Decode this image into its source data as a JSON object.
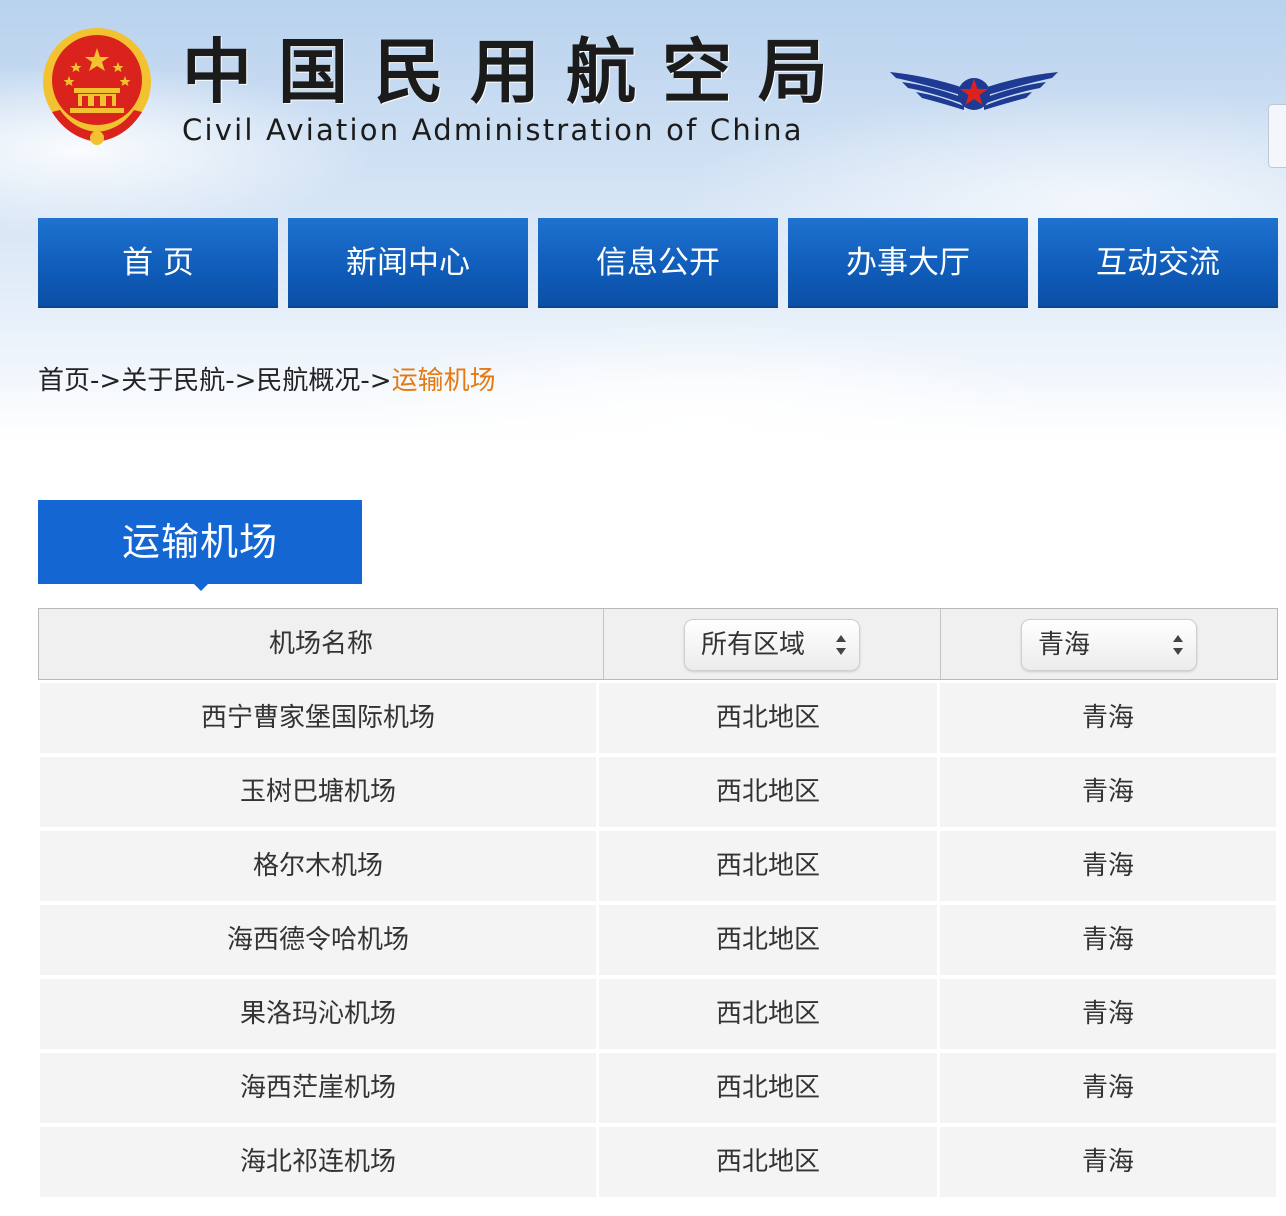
{
  "header": {
    "title_cn": "中国民用航空局",
    "title_en": "Civil Aviation Administration of China",
    "emblem_icon": "national-emblem-icon",
    "logo_icon": "caac-wings-logo-icon",
    "colors": {
      "nav_blue": "#1467d3",
      "accent_orange": "#e67a12",
      "emblem_red": "#d9231c",
      "emblem_gold": "#f2c230"
    }
  },
  "nav": {
    "items": [
      {
        "label": "首 页"
      },
      {
        "label": "新闻中心"
      },
      {
        "label": "信息公开"
      },
      {
        "label": "办事大厅"
      },
      {
        "label": "互动交流"
      }
    ]
  },
  "breadcrumb": {
    "items": [
      "首页",
      "关于民航",
      "民航概况"
    ],
    "separator": "->",
    "current": "运输机场"
  },
  "section": {
    "title": "运输机场"
  },
  "table": {
    "header": {
      "name_label": "机场名称",
      "region_select": "所有区域",
      "province_select": "青海"
    },
    "rows": [
      {
        "name": "西宁曹家堡国际机场",
        "region": "西北地区",
        "province": "青海"
      },
      {
        "name": "玉树巴塘机场",
        "region": "西北地区",
        "province": "青海"
      },
      {
        "name": "格尔木机场",
        "region": "西北地区",
        "province": "青海"
      },
      {
        "name": "海西德令哈机场",
        "region": "西北地区",
        "province": "青海"
      },
      {
        "name": "果洛玛沁机场",
        "region": "西北地区",
        "province": "青海"
      },
      {
        "name": "海西茫崖机场",
        "region": "西北地区",
        "province": "青海"
      },
      {
        "name": "海北祁连机场",
        "region": "西北地区",
        "province": "青海"
      }
    ]
  }
}
